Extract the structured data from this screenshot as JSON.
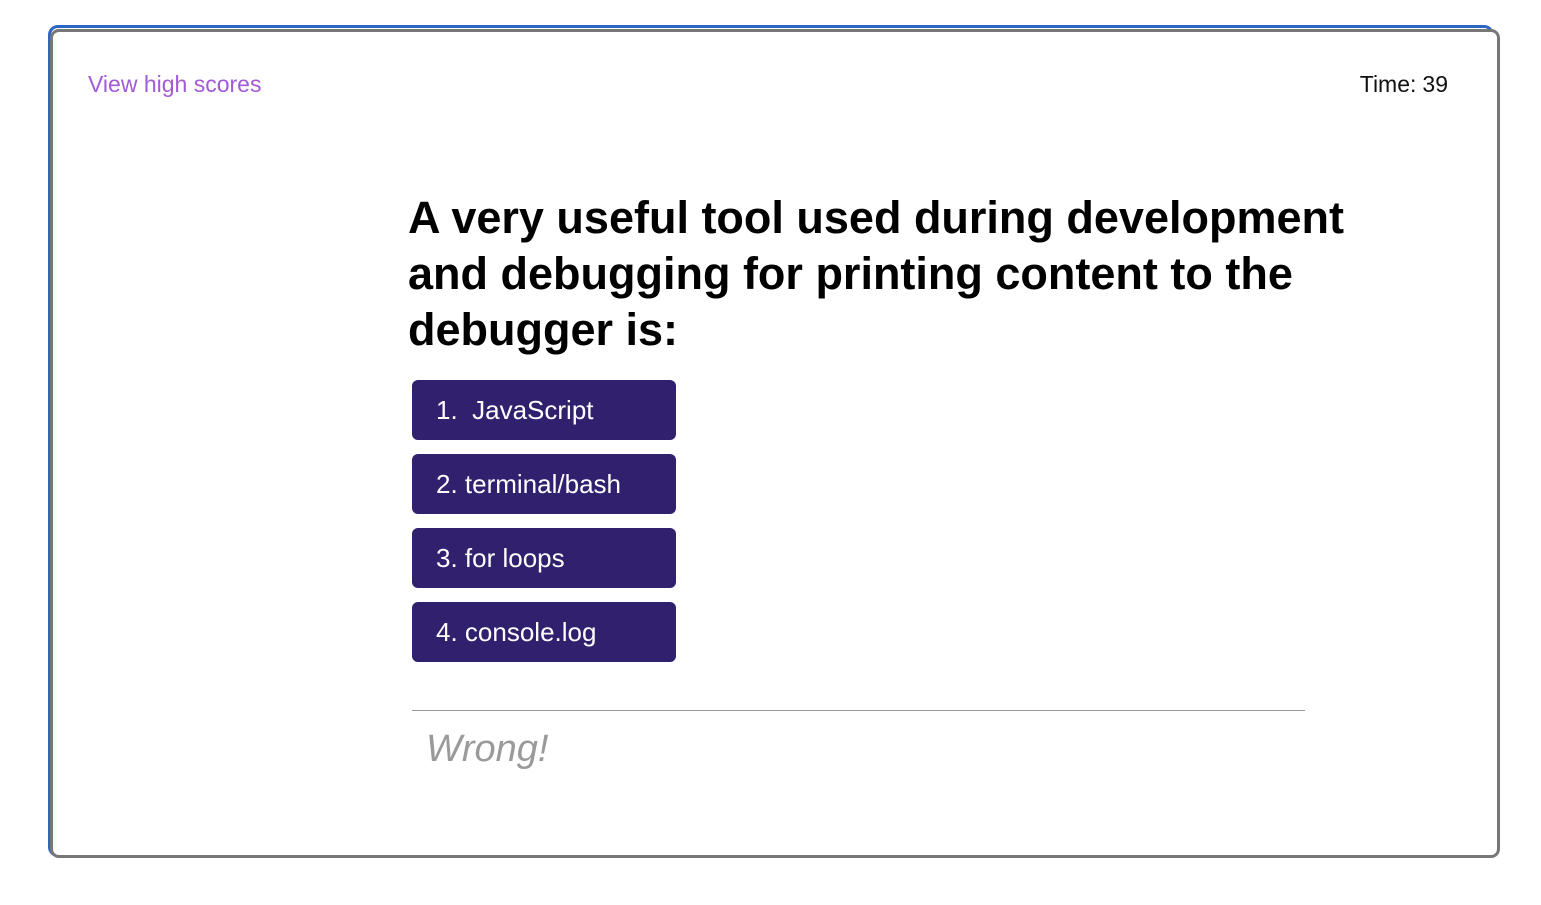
{
  "header": {
    "highscores_link": "View high scores",
    "timer_label": "Time:",
    "timer_value": "39"
  },
  "quiz": {
    "question": "A very useful tool used during development and debugging for printing content to the debugger is:",
    "answers": [
      {
        "label": "1.  JavaScript"
      },
      {
        "label": "2. terminal/bash"
      },
      {
        "label": "3. for loops"
      },
      {
        "label": "4. console.log"
      }
    ],
    "feedback": "Wrong!"
  },
  "colors": {
    "accent_link": "#a35ad6",
    "button_bg": "#31206e",
    "button_text": "#ffffff",
    "feedback_text": "#9a9a9a",
    "outer_frame": "#2f66c4",
    "inner_frame": "#777777"
  }
}
